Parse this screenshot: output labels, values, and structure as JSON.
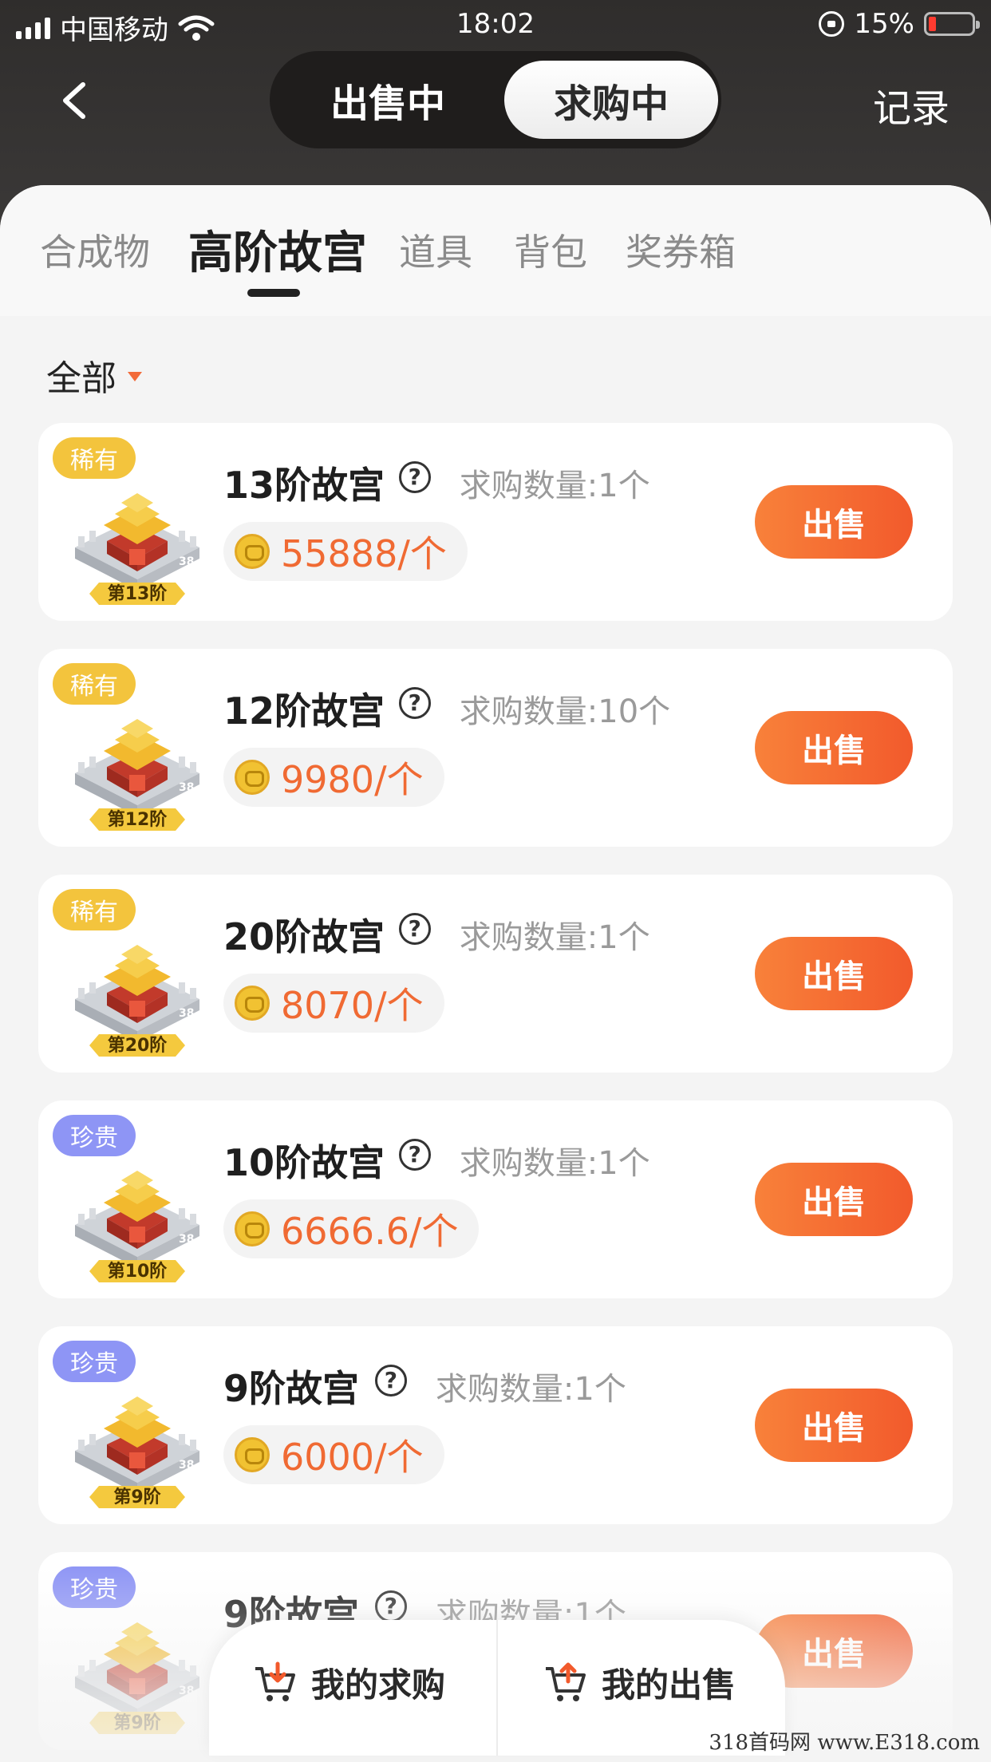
{
  "status_bar": {
    "carrier": "中国移动",
    "time": "18:02",
    "battery": "15%"
  },
  "header": {
    "segments": [
      "出售中",
      "求购中"
    ],
    "active_segment": "求购中",
    "record_label": "记录"
  },
  "tabs": [
    "合成物",
    "高阶故宫",
    "道具",
    "背包",
    "奖券箱"
  ],
  "active_tab": "高阶故宫",
  "filter": {
    "label": "全部"
  },
  "qty_label_prefix": "求购数量:",
  "items": [
    {
      "badge": "稀有",
      "badge_type": "rare",
      "name": "13阶故宫",
      "qty": "求购数量:1个",
      "price": "55888/个",
      "tier": "第13阶",
      "button": "出售"
    },
    {
      "badge": "稀有",
      "badge_type": "rare",
      "name": "12阶故宫",
      "qty": "求购数量:10个",
      "price": "9980/个",
      "tier": "第12阶",
      "button": "出售"
    },
    {
      "badge": "稀有",
      "badge_type": "rare",
      "name": "20阶故宫",
      "qty": "求购数量:1个",
      "price": "8070/个",
      "tier": "第20阶",
      "button": "出售"
    },
    {
      "badge": "珍贵",
      "badge_type": "precious",
      "name": "10阶故宫",
      "qty": "求购数量:1个",
      "price": "6666.6/个",
      "tier": "第10阶",
      "button": "出售"
    },
    {
      "badge": "珍贵",
      "badge_type": "precious",
      "name": "9阶故宫",
      "qty": "求购数量:1个",
      "price": "6000/个",
      "tier": "第9阶",
      "button": "出售"
    },
    {
      "badge": "珍贵",
      "badge_type": "precious",
      "name": "9阶故宫",
      "qty": "求购数量:1个",
      "price": "",
      "tier": "第9阶",
      "button": "出售"
    }
  ],
  "bottom_bar": {
    "my_purchase": "我的求购",
    "my_sale": "我的出售"
  },
  "watermark": "318首码网 www.E318.com",
  "colors": {
    "accent_orange": "#f25a2c",
    "rare_badge": "#f3c43d",
    "precious_badge": "#8e95f5",
    "header_bg": "#2f2d2c"
  }
}
